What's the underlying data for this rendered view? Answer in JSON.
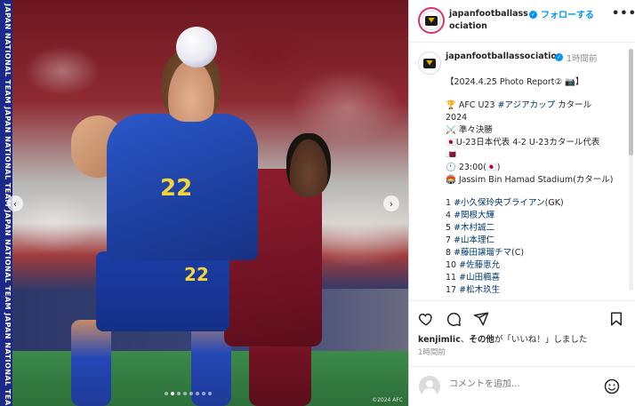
{
  "photo": {
    "side_text": "JAPAN NATIONAL TEAM  JAPAN NATIONAL TEAM  JAPAN NATIONAL TEAM  JAPAN NATIONAL TEAM",
    "jersey_number_top": "22",
    "jersey_number_shorts": "22",
    "copyright": "©2024 AFC",
    "carousel_total": 8,
    "carousel_active": 2
  },
  "header": {
    "username": "japanfootballassociation",
    "follow_label": "フォローする",
    "more_label": "•••"
  },
  "caption": {
    "username": "japanfootballassociation",
    "time": "1時間前",
    "lines": [
      {
        "text": "【2024.4.25 Photo Report② 📷】",
        "type": "text"
      },
      {
        "text": "",
        "type": "gap"
      },
      {
        "text": "🏆 AFC U23 ",
        "tag": "#アジアカップ",
        "after": " カタール",
        "type": "mixed"
      },
      {
        "text": "2024",
        "type": "text"
      },
      {
        "text": "⚔️ 準々決勝",
        "type": "text"
      },
      {
        "text": "🇯🇵U-23日本代表 4-2 U-23カタール代表",
        "type": "text"
      },
      {
        "text": "🇶🇦",
        "type": "text"
      },
      {
        "text": "🕚 23:00(🇯🇵)",
        "type": "text"
      },
      {
        "text": "🏟️ Jassim Bin Hamad Stadium(カタール)",
        "type": "text"
      },
      {
        "text": "",
        "type": "gap"
      },
      {
        "text": "1 ",
        "tag": "#小久保玲央ブライアン",
        "after": "(GK)",
        "type": "mixed"
      },
      {
        "text": "4 ",
        "tag": "#関根大輝",
        "after": "",
        "type": "mixed"
      },
      {
        "text": "5 ",
        "tag": "#木村誠二",
        "after": "",
        "type": "mixed"
      },
      {
        "text": "7 ",
        "tag": "#山本理仁",
        "after": "",
        "type": "mixed"
      },
      {
        "text": "8 ",
        "tag": "#藤田譲瑠チマ",
        "after": "(C)",
        "type": "mixed"
      },
      {
        "text": "10 ",
        "tag": "#佐藤恵允",
        "after": "",
        "type": "mixed"
      },
      {
        "text": "11 ",
        "tag": "#山田楓喜",
        "after": "",
        "type": "mixed"
      },
      {
        "text": "17 ",
        "tag": "#松木玖生",
        "after": "",
        "type": "mixed"
      }
    ]
  },
  "likes": {
    "user": "kenjimlic",
    "mid": "、",
    "others": "その他",
    "suffix": "が「いいね！」しました"
  },
  "posted_time": "1時間前",
  "comment": {
    "placeholder": "コメントを追加..."
  },
  "colors": {
    "link": "#0095f6",
    "hashtag": "#00376b",
    "muted": "#8e8e8e",
    "story_ring": "#d8336b"
  },
  "icons": [
    "heart-icon",
    "comment-icon",
    "share-icon",
    "bookmark-icon",
    "emoji-icon",
    "chevron-left-icon",
    "chevron-right-icon",
    "more-icon",
    "verified-icon"
  ]
}
